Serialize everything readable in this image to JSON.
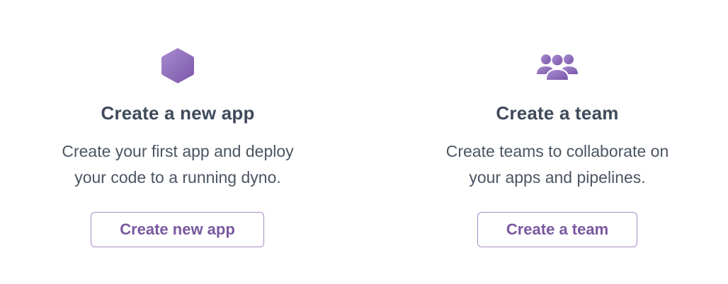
{
  "colors": {
    "accent": "#79589f",
    "button_border": "#a78dc4",
    "title": "#3f4a5a",
    "text": "#4b5563"
  },
  "cards": [
    {
      "icon": "hexagon-app-icon",
      "title": "Create a new app",
      "description_lines": [
        "Create your first app and deploy",
        "your code to a running dyno."
      ],
      "button_label": "Create new app"
    },
    {
      "icon": "team-people-icon",
      "title": "Create a team",
      "description_lines": [
        "Create teams to collaborate on",
        "your apps and pipelines."
      ],
      "button_label": "Create a team"
    }
  ]
}
